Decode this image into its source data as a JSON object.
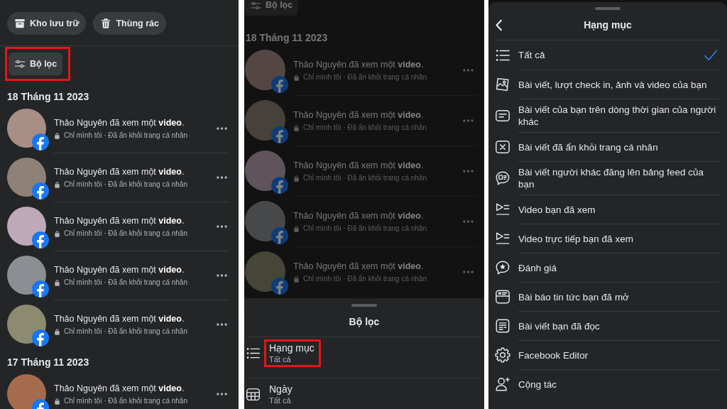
{
  "history_screen": {
    "top_buttons": [
      {
        "label": "Kho lưu trữ"
      },
      {
        "label": "Thùng rác"
      }
    ],
    "filter_button": {
      "label": "Bộ lọc",
      "highlighted": true
    },
    "sections": [
      {
        "date": "18 Tháng 11 2023",
        "items": [
          {
            "text": "Thảo Nguyên đã xem một **video**.",
            "meta": "Chỉ mình tôi · Đã ẩn khỏi trang cá nhân"
          },
          {
            "text": "Thảo Nguyên đã xem một **video**.",
            "meta": "Chỉ mình tôi · Đã ẩn khỏi trang cá nhân"
          },
          {
            "text": "Thảo Nguyên đã xem một **video**.",
            "meta": "Chỉ mình tôi · Đã ẩn khỏi trang cá nhân"
          },
          {
            "text": "Thảo Nguyên đã xem một **video**.",
            "meta": "Chỉ mình tôi · Đã ẩn khỏi trang cá nhân"
          },
          {
            "text": "Thảo Nguyên đã xem một **video**.",
            "meta": "Chỉ mình tôi · Đã ẩn khỏi trang cá nhân"
          }
        ]
      },
      {
        "date": "17 Tháng 11 2023",
        "items": [
          {
            "text": "Thảo Nguyên đã xem một **video**.",
            "meta": "Chỉ mình tôi · Đã ẩn khỏi trang cá nhân"
          }
        ]
      }
    ]
  },
  "filter_screen": {
    "background": {
      "dimmed": true,
      "filter_button": {
        "label": "Bộ lọc"
      },
      "sections": [
        {
          "date": "18 Tháng 11 2023",
          "items": [
            {
              "text": "Thảo Nguyên đã xem một **video**.",
              "meta": "Chỉ mình tôi · Đã ẩn khỏi trang cá nhân"
            },
            {
              "text": "Thảo Nguyên đã xem một **video**.",
              "meta": "Chỉ mình tôi · Đã ẩn khỏi trang cá nhân"
            },
            {
              "text": "Thảo Nguyên đã xem một **video**.",
              "meta": "Chỉ mình tôi · Đã ẩn khỏi trang cá nhân"
            },
            {
              "text": "Thảo Nguyên đã xem một **video**.",
              "meta": "Chỉ mình tôi · Đã ẩn khỏi trang cá nhân"
            },
            {
              "text": "Thảo Nguyên đã xem một **video**.",
              "meta": "Chỉ mình tôi · Đã ẩn khỏi trang cá nhân"
            }
          ]
        }
      ]
    },
    "sheet": {
      "title": "Bộ lọc",
      "options": [
        {
          "label": "Hạng mục",
          "value": "Tất cả",
          "highlighted": true
        },
        {
          "label": "Ngày",
          "value": "Tất cả",
          "highlighted": false
        }
      ]
    }
  },
  "category_screen": {
    "title": "Hạng mục",
    "items": [
      {
        "label": "Tất cả",
        "selected": true
      },
      {
        "label": "Bài viết, lượt check in, ảnh và video của bạn",
        "selected": false
      },
      {
        "label": "Bài viết của bạn trên dòng thời gian của người khác",
        "selected": false
      },
      {
        "label": "Bài viết đã ẩn khỏi trang cá nhân",
        "selected": false
      },
      {
        "label": "Bài viết người khác đăng lên bảng feed của bạn",
        "selected": false
      },
      {
        "label": "Video bạn đã xem",
        "selected": false
      },
      {
        "label": "Video trực tiếp bạn đã xem",
        "selected": false
      },
      {
        "label": "Đánh giá",
        "selected": false
      },
      {
        "label": "Bài báo tin tức bạn đã mở",
        "selected": false
      },
      {
        "label": "Bài viết bạn đã đọc",
        "selected": false
      },
      {
        "label": "Facebook Editor",
        "selected": false
      },
      {
        "label": "Cộng tác",
        "selected": false
      }
    ]
  }
}
